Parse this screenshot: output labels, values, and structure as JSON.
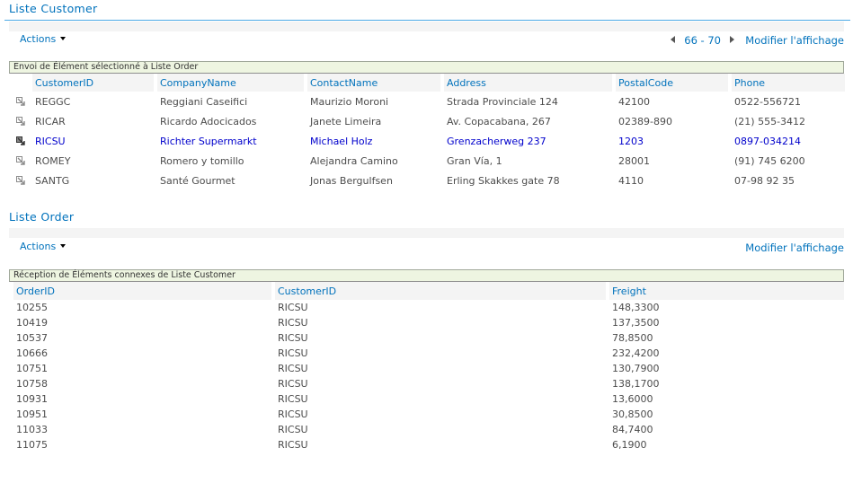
{
  "customer_part": {
    "title": "Liste Customer",
    "actions_label": "Actions",
    "pager": {
      "range": "66 - 70"
    },
    "modify_view_label": "Modifier l'affichage",
    "connection_text": "Envoi de Élément sélectionné à Liste Order",
    "columns": [
      "CustomerID",
      "CompanyName",
      "ContactName",
      "Address",
      "PostalCode",
      "Phone"
    ],
    "rows": [
      {
        "selected": false,
        "cells": [
          "REGGC",
          "Reggiani Caseifici",
          "Maurizio Moroni",
          "Strada Provinciale 124",
          "42100",
          "0522-556721"
        ]
      },
      {
        "selected": false,
        "cells": [
          "RICAR",
          "Ricardo Adocicados",
          "Janete Limeira",
          "Av. Copacabana, 267",
          "02389-890",
          "(21) 555-3412"
        ]
      },
      {
        "selected": true,
        "cells": [
          "RICSU",
          "Richter Supermarkt",
          "Michael Holz",
          "Grenzacherweg 237",
          "1203",
          "0897-034214"
        ]
      },
      {
        "selected": false,
        "cells": [
          "ROMEY",
          "Romero y tomillo",
          "Alejandra Camino",
          "Gran Vía, 1",
          "28001",
          "(91) 745 6200"
        ]
      },
      {
        "selected": false,
        "cells": [
          "SANTG",
          "Santé Gourmet",
          "Jonas Bergulfsen",
          "Erling Skakkes gate 78",
          "4110",
          "07-98 92 35"
        ]
      }
    ]
  },
  "order_part": {
    "title": "Liste Order",
    "actions_label": "Actions",
    "modify_view_label": "Modifier l'affichage",
    "connection_text": "Réception de Éléments connexes de Liste Customer",
    "columns": [
      "OrderID",
      "CustomerID",
      "Freight"
    ],
    "rows": [
      [
        "10255",
        "RICSU",
        "148,3300"
      ],
      [
        "10419",
        "RICSU",
        "137,3500"
      ],
      [
        "10537",
        "RICSU",
        "78,8500"
      ],
      [
        "10666",
        "RICSU",
        "232,4200"
      ],
      [
        "10751",
        "RICSU",
        "130,7900"
      ],
      [
        "10758",
        "RICSU",
        "138,1700"
      ],
      [
        "10931",
        "RICSU",
        "13,6000"
      ],
      [
        "10951",
        "RICSU",
        "30,8500"
      ],
      [
        "11033",
        "RICSU",
        "84,7400"
      ],
      [
        "11075",
        "RICSU",
        "6,1900"
      ]
    ]
  },
  "colors": {
    "link": "#0072bc",
    "selected_row": "#0000cc",
    "title_rule": "#4ca9e6",
    "connection_bar": "#eef5e1"
  }
}
